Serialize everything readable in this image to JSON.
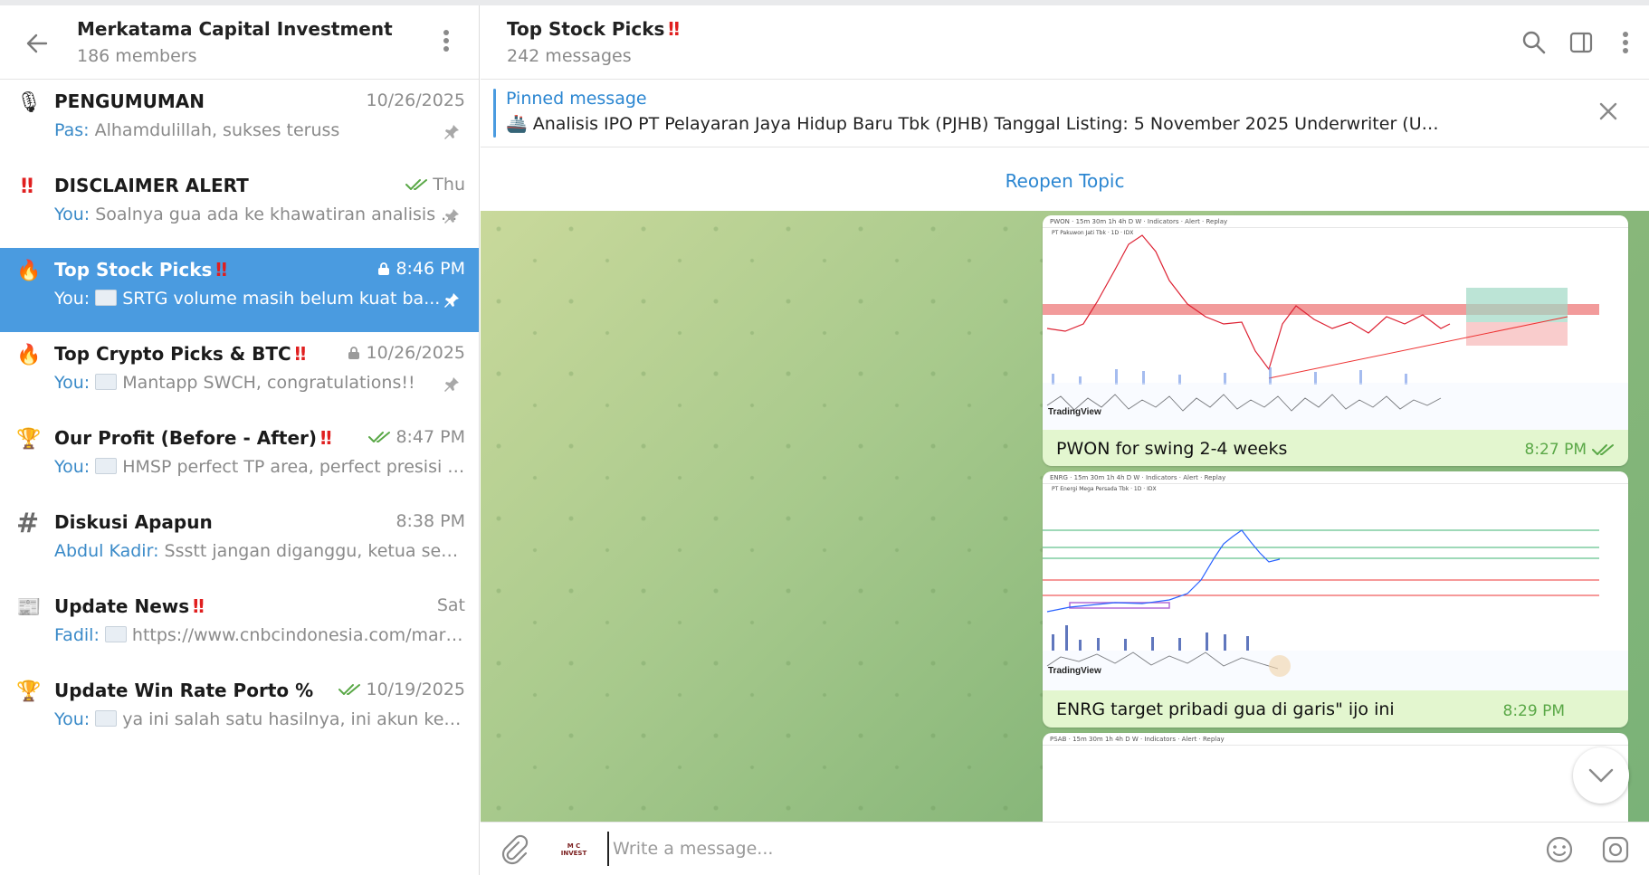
{
  "left": {
    "group_title": "Merkatama Capital Investment",
    "members": "186 members",
    "topics": [
      {
        "icon": "🎙",
        "name": "PENGUMUMAN",
        "excl": "",
        "time": "10/26/2025",
        "sender": "Pas:",
        "preview": " Alhamdulillah, sukses teruss",
        "pinned": true,
        "active": false,
        "check": false,
        "lock": false,
        "thumb": false
      },
      {
        "icon": "‼",
        "name": "DISCLAIMER ALERT",
        "excl": "",
        "time": "Thu",
        "sender": "You:",
        "preview": " Soalnya gua ada ke khawatiran analisis ...",
        "pinned": true,
        "active": false,
        "check": true,
        "lock": false,
        "thumb": false
      },
      {
        "icon": "🔥",
        "name": "Top Stock Picks",
        "excl": "‼",
        "time": "8:46 PM",
        "sender": "You:",
        "preview": "SRTG volume masih belum kuat ba...",
        "pinned": true,
        "active": true,
        "check": false,
        "lock": true,
        "thumb": true
      },
      {
        "icon": "🔥",
        "name": "Top Crypto Picks & BTC",
        "excl": "‼",
        "time": "10/26/2025",
        "sender": "You:",
        "preview": "Mantapp SWCH, congratulations!!",
        "pinned": true,
        "active": false,
        "check": false,
        "lock": true,
        "thumb": true
      },
      {
        "icon": "🏆",
        "name": "Our Profit (Before - After)",
        "excl": "‼",
        "time": "8:47 PM",
        "sender": "You:",
        "preview": "HMSP perfect TP area, perfect presisi wk...",
        "pinned": false,
        "active": false,
        "check": true,
        "lock": false,
        "thumb": true
      },
      {
        "icon": "#",
        "name": "Diskusi Apapun",
        "excl": "",
        "time": "8:38 PM",
        "sender": "Abdul Kadir:",
        "preview": " Ssstt jangan diganggu, ketua sedan...",
        "pinned": false,
        "active": false,
        "check": false,
        "lock": false,
        "thumb": false
      },
      {
        "icon": "📰",
        "name": "Update News",
        "excl": "‼",
        "time": "Sat",
        "sender": "Fadil:",
        "preview": "https://www.cnbcindonesia.com/marke...",
        "pinned": false,
        "active": false,
        "check": false,
        "lock": false,
        "thumb": true
      },
      {
        "icon": "🏆",
        "name": "Update Win Rate Porto %",
        "excl": "",
        "time": "10/19/2025",
        "sender": "You:",
        "preview": "ya ini salah satu hasilnya, ini akun kec...",
        "pinned": false,
        "active": false,
        "check": true,
        "lock": false,
        "thumb": true
      }
    ]
  },
  "right": {
    "title": "Top Stock Picks",
    "title_excl": "‼",
    "messages_count": "242 messages",
    "pinned_label": "Pinned message",
    "pinned_text": "🚢 Analisis IPO PT Pelayaran Jaya Hidup Baru Tbk (PJHB)  Tanggal Listing: 5 November 2025 Underwriter (UW): PT Pilarmas Invest...",
    "reopen_label": "Reopen Topic",
    "messages": [
      {
        "caption": "PWON for swing 2-4 weeks",
        "time": "8:27 PM",
        "chart_title": "PT Pakuwon Jati Tbk · 1D · IDX",
        "ticker": "PWON"
      },
      {
        "caption": "ENRG target pribadi gua di garis\" ijo ini",
        "time": "8:29 PM",
        "chart_title": "PT Energi Mega Persada Tbk · 1D · IDX",
        "ticker": "ENRG"
      },
      {
        "ticker": "PSAB"
      }
    ],
    "tv_brand": "TradingView",
    "composer_placeholder": "Write a message..."
  },
  "colors": {
    "accent": "#4a9be0",
    "link": "#2b86d1",
    "bubble": "#e3f6cf",
    "check": "#5aa847",
    "excl": "#e01f1f"
  }
}
